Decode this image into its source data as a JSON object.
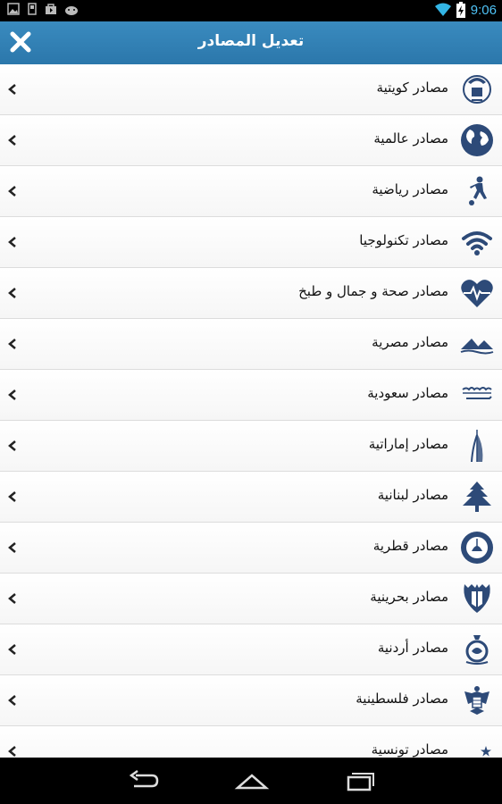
{
  "status_bar": {
    "time": "9:06"
  },
  "app_bar": {
    "title": "تعديل المصادر"
  },
  "sources": [
    {
      "label": "مصادر كويتية",
      "icon": "kuwait-emblem-icon"
    },
    {
      "label": "مصادر عالمية",
      "icon": "globe-icon"
    },
    {
      "label": "مصادر رياضية",
      "icon": "football-player-icon"
    },
    {
      "label": "مصادر تكنولوجيا",
      "icon": "wifi-icon"
    },
    {
      "label": "مصادر صحة و جمال و طبخ",
      "icon": "heart-pulse-icon"
    },
    {
      "label": "مصادر مصرية",
      "icon": "pyramids-icon"
    },
    {
      "label": "مصادر سعودية",
      "icon": "saudi-flag-icon"
    },
    {
      "label": "مصادر إماراتية",
      "icon": "burj-al-arab-icon"
    },
    {
      "label": "مصادر لبنانية",
      "icon": "cedar-tree-icon"
    },
    {
      "label": "مصادر قطرية",
      "icon": "qatar-emblem-icon"
    },
    {
      "label": "مصادر بحرينية",
      "icon": "bahrain-emblem-icon"
    },
    {
      "label": "مصادر أردنية",
      "icon": "jordan-emblem-icon"
    },
    {
      "label": "مصادر فلسطينية",
      "icon": "eagle-emblem-icon"
    },
    {
      "label": "مصادر تونسية",
      "icon": "crescent-star-icon"
    }
  ],
  "colors": {
    "app_bar": "#2f80b4",
    "icon": "#2d4a78",
    "clock": "#4fc3f7"
  }
}
